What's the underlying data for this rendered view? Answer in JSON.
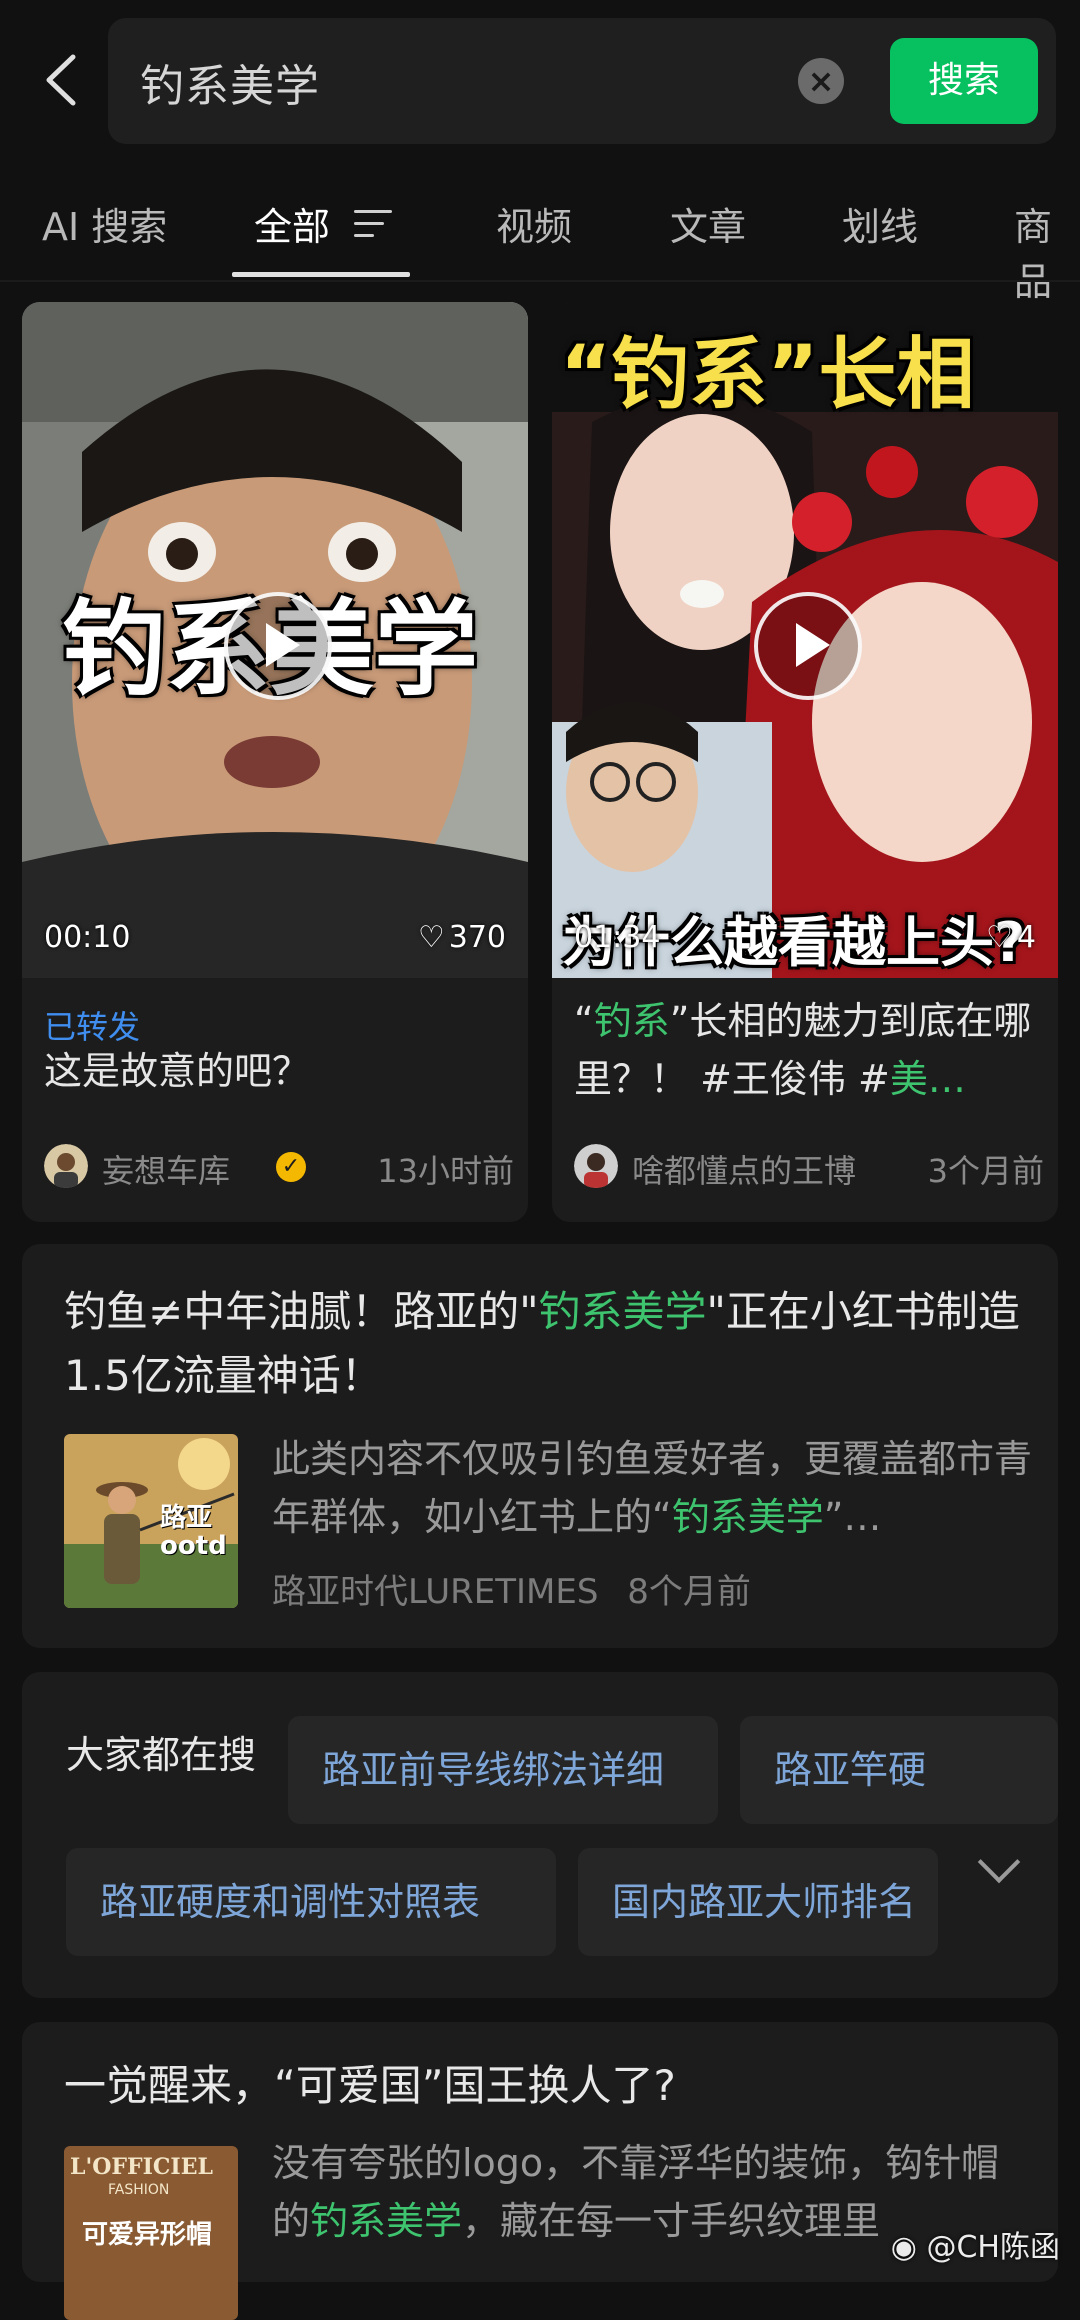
{
  "search": {
    "query": "钓系美学",
    "button_label": "搜索"
  },
  "tabs": [
    {
      "label": "AI 搜索"
    },
    {
      "label": "全部"
    },
    {
      "label": "视频"
    },
    {
      "label": "文章"
    },
    {
      "label": "划线"
    },
    {
      "label": "商品"
    }
  ],
  "videos": [
    {
      "overlay_text": "钓系美学",
      "duration": "00:10",
      "likes": "370",
      "shared_label": "已转发",
      "title": "这是故意的吧？",
      "author": "妄想车库",
      "time": "13小时前"
    },
    {
      "overlay_top": "“钓系”长相",
      "overlay_bottom": "为什么越看越上头?",
      "duration": "01:34",
      "likes": "4",
      "title_parts": [
        "“",
        "钓系",
        "”长相的魅力到底在哪里？！ #王俊伟 #",
        "美…"
      ],
      "author": "啥都懂点的王博",
      "time": "3个月前"
    }
  ],
  "articles": [
    {
      "title_parts": [
        "钓鱼≠中年油腻！路亚的\"",
        "钓系美学",
        "\"正在小红书制造1.5亿流量神话！"
      ],
      "thumb_text": "路亚 ootd",
      "desc_parts": [
        "此类内容不仅吸引钓鱼爱好者，更覆盖都市青年群体，如小红书上的“",
        "钓系美学",
        "”…"
      ],
      "source": "路亚时代LURETIMES",
      "time": "8个月前"
    },
    {
      "title": "一觉醒来，“可爱国”国王换人了?",
      "thumb_brand": "L'OFFICIEL",
      "thumb_sub": "FASHION",
      "thumb_caption": "可爱异形帽",
      "desc_parts": [
        "没有夸张的logo，不靠浮华的装饰，钩针帽的",
        "钓系美学",
        "，藏在每一寸手织纹理里"
      ]
    }
  ],
  "trending": {
    "label": "大家都在搜",
    "chips": [
      "路亚前导线绑法详细",
      "路亚竿硬",
      "路亚硬度和调性对照表",
      "国内路亚大师排名"
    ]
  },
  "watermark": "@CH陈函",
  "colors": {
    "accent_green": "#07c160",
    "highlight_green": "#3ec46f",
    "link_blue": "#3f8ef0",
    "verified_gold": "#f5b800"
  }
}
